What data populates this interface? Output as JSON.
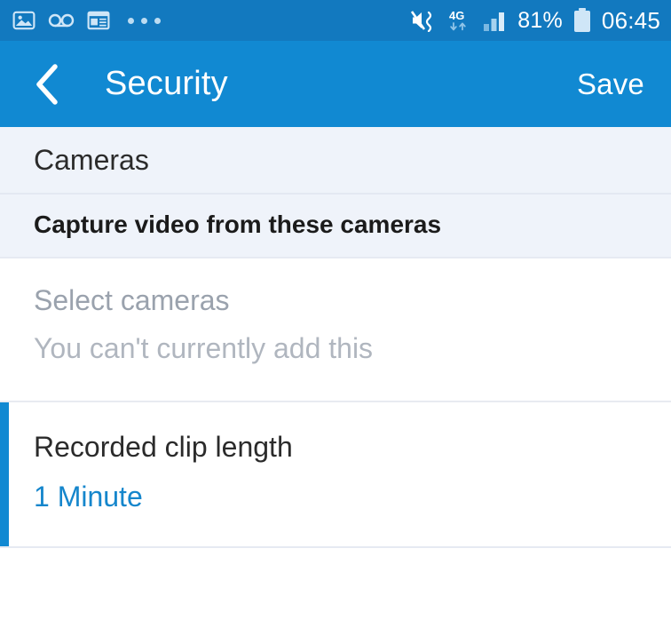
{
  "status_bar": {
    "background": "#1279bf",
    "left_icons": [
      {
        "name": "image-icon",
        "label": "photo"
      },
      {
        "name": "voicemail-icon",
        "label": "voicemail"
      },
      {
        "name": "news-panel-icon",
        "label": "news"
      }
    ],
    "overflow_label": "more notifications",
    "network_type": "4G",
    "battery_percent": "81%",
    "time": "06:45",
    "right_icons": [
      {
        "name": "mute-vibrate-icon",
        "label": "sound off vibrate"
      },
      {
        "name": "signal-bars-icon",
        "label": "signal strength"
      },
      {
        "name": "battery-icon",
        "label": "battery"
      }
    ]
  },
  "app_bar": {
    "background": "#1189d2",
    "back_label": "Back",
    "title": "Security",
    "save_label": "Save"
  },
  "content": {
    "section": {
      "header": "Cameras",
      "toggle_row_label": "Capture video from these cameras"
    },
    "disabled_item": {
      "primary": "Select cameras",
      "secondary": "You can't currently add this"
    },
    "clip_length": {
      "title": "Recorded clip length",
      "value": "1 Minute",
      "accent_color": "#1189d2"
    }
  }
}
